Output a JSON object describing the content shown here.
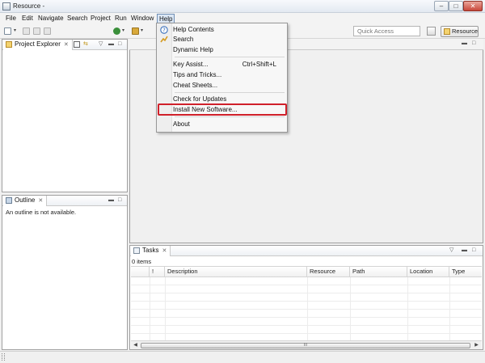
{
  "window": {
    "title": "Resource -",
    "minimize_glyph": "–",
    "maximize_glyph": "□",
    "close_glyph": "✕"
  },
  "menubar": {
    "items": [
      {
        "label": "File"
      },
      {
        "label": "Edit"
      },
      {
        "label": "Navigate"
      },
      {
        "label": "Search"
      },
      {
        "label": "Project"
      },
      {
        "label": "Run"
      },
      {
        "label": "Window"
      },
      {
        "label": "Help"
      }
    ]
  },
  "toolbar": {
    "quick_access_placeholder": "Quick Access",
    "perspective_label": "Resource"
  },
  "views": {
    "project_explorer": {
      "title": "Project Explorer"
    },
    "outline": {
      "title": "Outline",
      "message": "An outline is not available."
    },
    "tasks": {
      "title": "Tasks",
      "count": "0 items",
      "columns": [
        "!",
        "Description",
        "Resource",
        "Path",
        "Location",
        "Type"
      ],
      "scroll_grip": "III"
    }
  },
  "help_menu": {
    "items": [
      {
        "label": "Help Contents",
        "icon": "help-icon"
      },
      {
        "label": "Search",
        "icon": "search-icon"
      },
      {
        "label": "Dynamic Help",
        "icon": ""
      },
      {
        "label": "Key Assist...",
        "shortcut": "Ctrl+Shift+L"
      },
      {
        "label": "Tips and Tricks..."
      },
      {
        "label": "Cheat Sheets..."
      },
      {
        "label": "Check for Updates"
      },
      {
        "label": "Install New Software..."
      },
      {
        "label": "About"
      }
    ]
  },
  "colors": {
    "highlight": "#d0202a",
    "menu_active": "#dbe7f5"
  }
}
